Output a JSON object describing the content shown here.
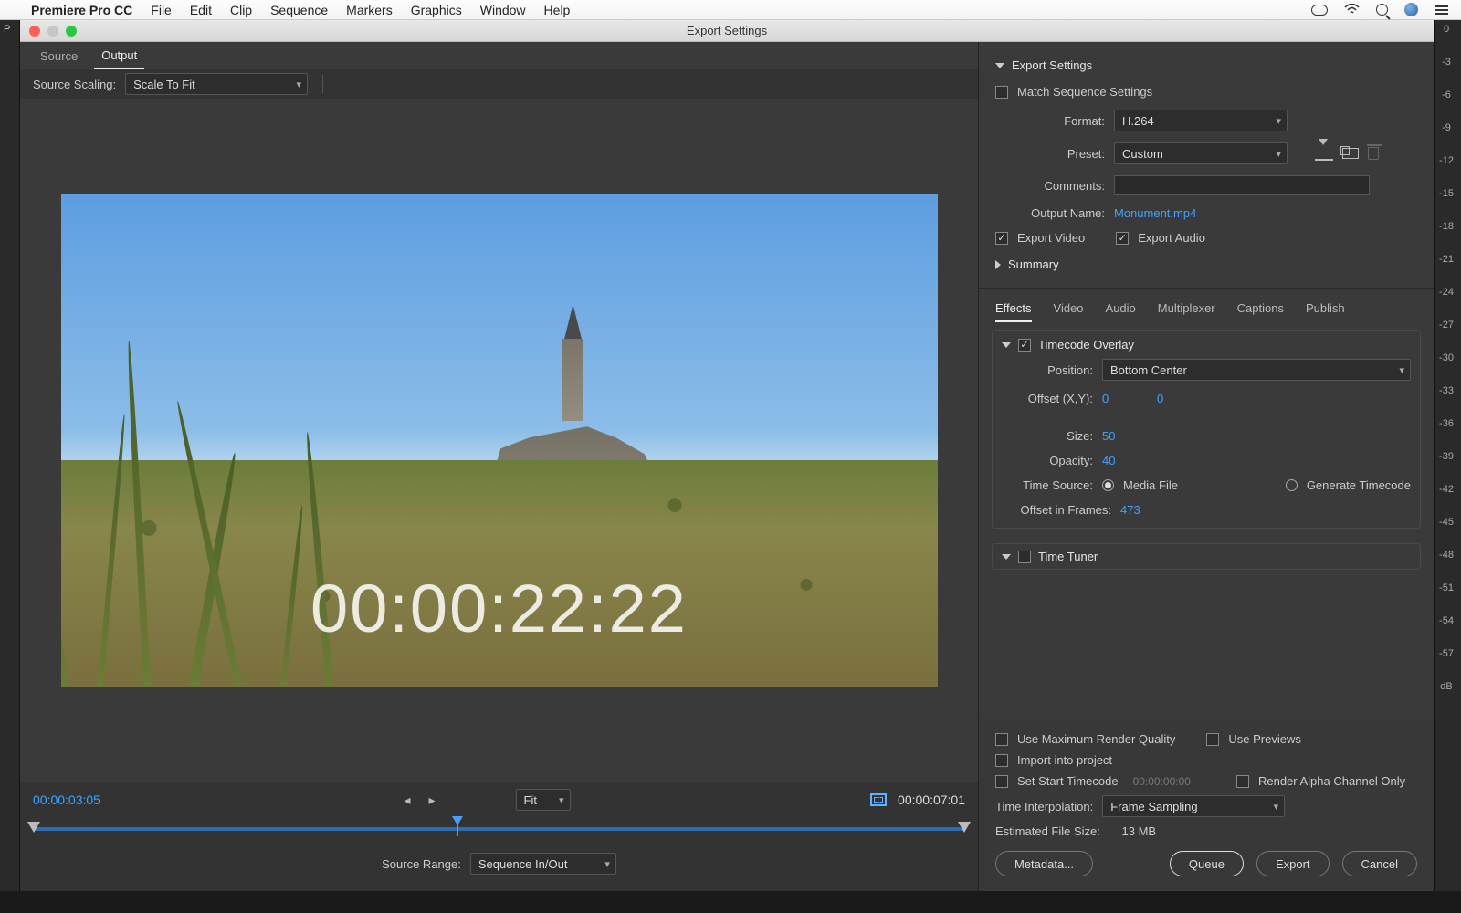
{
  "menubar": {
    "app": "Premiere Pro CC",
    "items": [
      "File",
      "Edit",
      "Clip",
      "Sequence",
      "Markers",
      "Graphics",
      "Window",
      "Help"
    ]
  },
  "dialog_title": "Export Settings",
  "preview": {
    "tabs": [
      "Source",
      "Output"
    ],
    "active_tab": 1,
    "scaling_label": "Source Scaling:",
    "scaling_value": "Scale To Fit",
    "tc_overlay": "00:00:22:22",
    "tc_left": "00:00:03:05",
    "tc_right": "00:00:07:01",
    "fit_label": "Fit",
    "range_label": "Source Range:",
    "range_value": "Sequence In/Out"
  },
  "export": {
    "heading": "Export Settings",
    "match_label": "Match Sequence Settings",
    "format_label": "Format:",
    "format_value": "H.264",
    "preset_label": "Preset:",
    "preset_value": "Custom",
    "comments_label": "Comments:",
    "output_label": "Output Name:",
    "output_value": "Monument.mp4",
    "video_label": "Export Video",
    "audio_label": "Export Audio",
    "summary_label": "Summary"
  },
  "tabs": [
    "Effects",
    "Video",
    "Audio",
    "Multiplexer",
    "Captions",
    "Publish"
  ],
  "tco": {
    "heading": "Timecode Overlay",
    "pos_label": "Position:",
    "pos_value": "Bottom Center",
    "offset_label": "Offset (X,Y):",
    "offx": "0",
    "offy": "0",
    "size_label": "Size:",
    "size_value": "50",
    "opacity_label": "Opacity:",
    "opacity_value": "40",
    "src_label": "Time Source:",
    "src_media": "Media File",
    "src_gen": "Generate Timecode",
    "frames_label": "Offset in Frames:",
    "frames_value": "473"
  },
  "tuner_label": "Time Tuner",
  "footer": {
    "maxq": "Use Maximum Render Quality",
    "usep": "Use Previews",
    "import": "Import into project",
    "starttc": "Set Start Timecode",
    "starttc_val": "00:00:00:00",
    "alpha": "Render Alpha Channel Only",
    "interp_label": "Time Interpolation:",
    "interp_value": "Frame Sampling",
    "size_label": "Estimated File Size:",
    "size_value": "13 MB",
    "metadata": "Metadata...",
    "queue": "Queue",
    "export": "Export",
    "cancel": "Cancel"
  },
  "db_scale": [
    "0",
    "-3",
    "-6",
    "-9",
    "-12",
    "-15",
    "-18",
    "-21",
    "-24",
    "-27",
    "-30",
    "-33",
    "-36",
    "-39",
    "-42",
    "-45",
    "-48",
    "-51",
    "-54",
    "-57",
    "dB"
  ]
}
